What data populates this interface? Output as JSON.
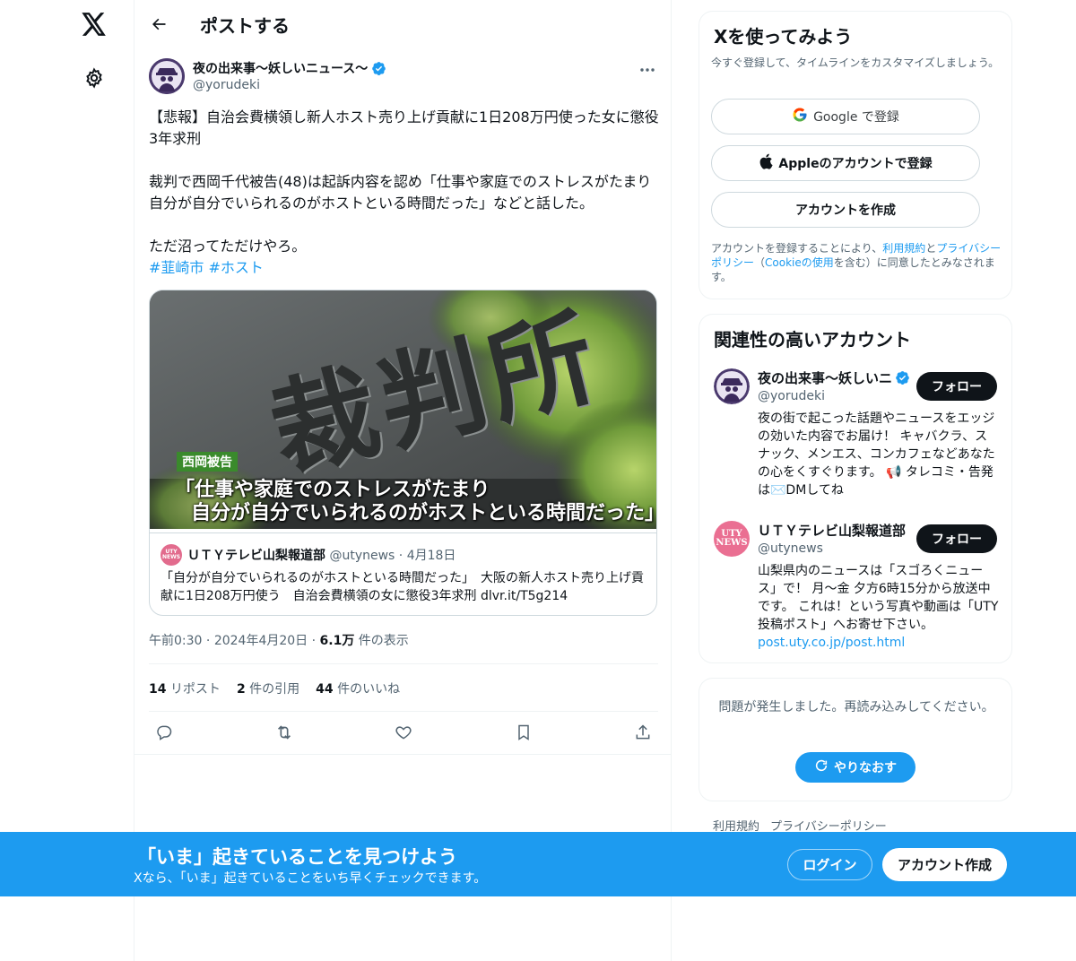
{
  "header": {
    "title": "ポストする"
  },
  "tweet": {
    "author_name": "夜の出来事〜妖しいニュース〜",
    "author_handle": "@yorudeki",
    "text": "【悲報】自治会費横領し新人ホスト売り上げ貢献に1日208万円使った女に懲役3年求刑\n\n裁判で西岡千代被告(48)は起訴内容を認め「仕事や家庭でのストレスがたまり自分が自分でいられるのがホストといる時間だった」などと話した。\n\nただ沼ってただけやろ。",
    "hashtags": "#韮崎市 #ホスト",
    "media": {
      "sign_text": "裁判所",
      "caption_label": "西岡被告",
      "caption_line1": "「仕事や家庭でのストレスがたまり",
      "caption_line2": "自分が自分でいられるのがホストといる時間だった」"
    },
    "quote": {
      "avatar_text": "UTY NEWS",
      "name": "ＵＴＹテレビ山梨報道部",
      "handle": "@utynews",
      "separator": "·",
      "date": "4月18日",
      "text": "「自分が自分でいられるのがホストといる時間だった」　大阪の新人ホスト売り上げ貢献に1日208万円使う　自治会費横領の女に懲役3年求刑 dlvr.it/T5g214"
    },
    "time": "午前0:30",
    "dot": "·",
    "date": "2024年4月20日",
    "views_count": "6.1万",
    "views_label": "件の表示",
    "reposts_count": "14",
    "reposts_label": "リポスト",
    "quotes_count": "2",
    "quotes_label": "件の引用",
    "likes_count": "44",
    "likes_label": "件のいいね"
  },
  "signup": {
    "title": "Xを使ってみよう",
    "subtitle": "今すぐ登録して、タイムラインをカスタマイズしましょう。",
    "google_label": "Google で登録",
    "apple_label": "Appleのアカウントで登録",
    "create_label": "アカウントを作成",
    "legal_prefix": "アカウントを登録することにより、",
    "legal_terms": "利用規約",
    "legal_and": "と",
    "legal_privacy": "プライバシーポリシー",
    "legal_paren_open": "（",
    "legal_cookie": "Cookieの使用",
    "legal_suffix": "を含む）に同意したとみなされます。"
  },
  "related": {
    "title": "関連性の高いアカウント",
    "accounts": [
      {
        "name": "夜の出来事〜妖しいニ",
        "handle": "@yorudeki",
        "follow_label": "フォロー",
        "bio": "夜の街で起こった話題やニュースをエッジの効いた内容でお届け！ キャバクラ、スナック、メンエス、コンカフェなどあなたの心をくすぐります。 📢 タレコミ・告発は✉️DMしてね",
        "link": ""
      },
      {
        "name": "ＵＴＹテレビ山梨報道部",
        "handle": "@utynews",
        "follow_label": "フォロー",
        "avatar_text": "UTY NEWS",
        "bio": "山梨県内のニュースは「スゴろくニュース」で！ 月〜金 夕方6時15分から放送中です。 これは！という写真や動画は「UTY投稿ポスト」へお寄せ下さい。",
        "link": "post.uty.co.jp/post.html"
      }
    ]
  },
  "error_box": {
    "message": "問題が発生しました。再読み込みしてください。",
    "retry_label": "やりなおす"
  },
  "footer": {
    "terms": "利用規約",
    "privacy": "プライバシーポリシー"
  },
  "banner": {
    "title": "「いま」起きていることを見つけよう",
    "subtitle": "Xなら、「いま」起きていることをいち早くチェックできます。",
    "login_label": "ログイン",
    "signup_label": "アカウント作成"
  },
  "colors": {
    "accent": "#1d9bf0",
    "text": "#0f1419",
    "muted": "#536471"
  }
}
